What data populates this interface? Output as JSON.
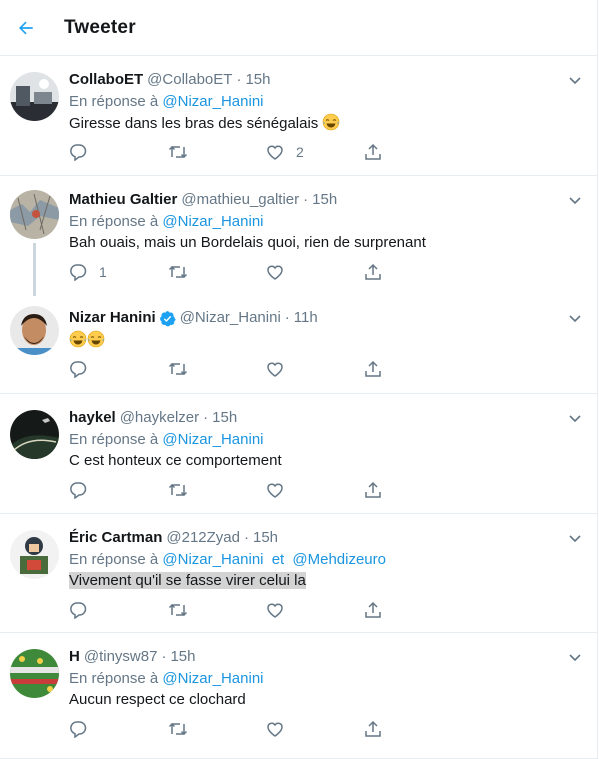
{
  "header": {
    "title": "Tweeter"
  },
  "reply_prefix": "En réponse à",
  "reply_joiner": "et",
  "emoji": "😂",
  "tweets": [
    {
      "name": "CollaboET",
      "handle": "@CollaboET",
      "time": "15h",
      "reply_to": [
        "@Nizar_Hanini"
      ],
      "text": "Giresse dans les bras des sénégalais",
      "likes": "2",
      "replies": ""
    },
    {
      "name": "Mathieu Galtier",
      "handle": "@mathieu_galtier",
      "time": "15h",
      "reply_to": [
        "@Nizar_Hanini"
      ],
      "text": "Bah ouais, mais un Bordelais quoi, rien de surprenant",
      "likes": "",
      "replies": "1"
    },
    {
      "name": "Nizar Hanini",
      "handle": "@Nizar_Hanini",
      "time": "11h",
      "verified": true,
      "text": "",
      "likes": "",
      "replies": ""
    },
    {
      "name": "haykel",
      "handle": "@haykelzer",
      "time": "15h",
      "reply_to": [
        "@Nizar_Hanini"
      ],
      "text": "C est honteux ce comportement",
      "likes": "",
      "replies": ""
    },
    {
      "name": "Éric Cartman",
      "handle": "@212Zyad",
      "time": "15h",
      "reply_to": [
        "@Nizar_Hanini",
        "@Mehdizeuro"
      ],
      "text": "Vivement qu'il se fasse virer celui la",
      "highlighted": true,
      "likes": "",
      "replies": ""
    },
    {
      "name": "H",
      "handle": "@tinysw87",
      "time": "15h",
      "reply_to": [
        "@Nizar_Hanini"
      ],
      "text": "Aucun respect ce clochard",
      "likes": "",
      "replies": ""
    }
  ],
  "colors": {
    "link": "#1b95e0",
    "secondary": "#657786",
    "verified": "#1da1f2",
    "divider": "#e6ecf0"
  },
  "icons": {
    "back": "arrow-left-icon",
    "more": "chevron-down-icon",
    "reply": "comment-icon",
    "retweet": "retweet-icon",
    "like": "heart-icon",
    "share": "share-icon",
    "verified": "verified-badge-icon"
  }
}
